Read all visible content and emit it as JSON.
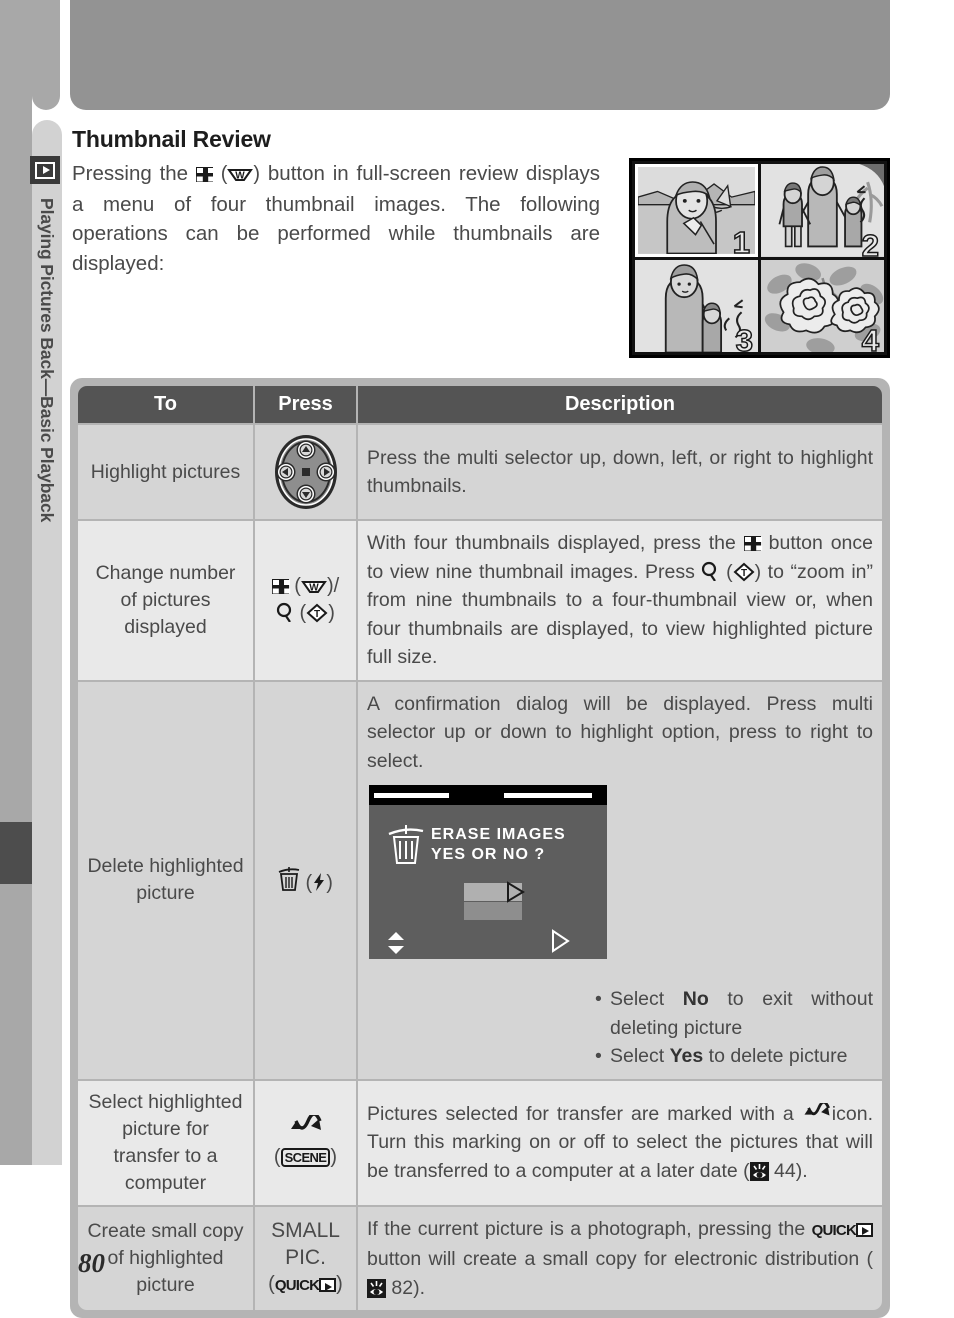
{
  "page": {
    "number": "80",
    "chapter_tab": "Playing Pictures Back—Basic Playback",
    "playback_icon": "playback-icon"
  },
  "section": {
    "title": "Thumbnail Review",
    "intro_before_icon": "Pressing the",
    "intro_after_icon": "button in full-screen review displays a menu of four thumbnail images.  The following operations can be performed while thumbnails are displayed:"
  },
  "thumbnails": {
    "items": [
      {
        "number": "1",
        "selected": true,
        "caption": "woman-beach-sailboat"
      },
      {
        "number": "2",
        "selected": false,
        "caption": "mother-with-two-children"
      },
      {
        "number": "3",
        "selected": false,
        "caption": "woman-holding-childs-hand"
      },
      {
        "number": "4",
        "selected": false,
        "caption": "flowers-close-up"
      }
    ]
  },
  "table": {
    "headers": {
      "to": "To",
      "press": "Press",
      "description": "Description"
    },
    "rows": [
      {
        "to": "Highlight pictures",
        "press_icon": "multi-selector",
        "description": "Press the multi selector up, down, left, or right to highlight thumbnails."
      },
      {
        "to": "Change number of pictures displayed",
        "press_line1": "( )/",
        "press_line2": "( )",
        "press_w": "W",
        "press_t": "T",
        "desc_p1": "With four thumbnails displayed, press the",
        "desc_p2": "button once to view nine thumbnail images.  Press",
        "desc_p3": "(",
        "desc_p4": ") to “zoom in” from nine thumbnails to a four-thumbnail view or, when four thumbnails are displayed, to view highlighted picture full size."
      },
      {
        "to": "Delete highlighted picture",
        "press_icon": "trash-icon",
        "press_paren": "flash-icon",
        "description": "A confirmation dialog will be displayed.  Press multi selector up or down to highlight option, press to right to select.",
        "lcd": {
          "line1": "ERASE IMAGES",
          "line2": "YES OR NO  ?"
        },
        "bullets": [
          {
            "pre": "Select ",
            "bold": "No",
            "post": " to exit without deleting picture"
          },
          {
            "pre": "Select ",
            "bold": "Yes",
            "post": " to delete picture"
          }
        ]
      },
      {
        "to": "Select highlighted picture for transfer to a computer",
        "press_icon": "transfer-icon",
        "press_label": "SCENE",
        "desc_p1": "Pictures selected for transfer are marked with a",
        "desc_p2": "icon.  Turn this marking on or off to select the pictures that will be transferred to a computer at a later date (",
        "desc_ref": "44",
        "desc_p3": ")."
      },
      {
        "to": "Create small copy of highlighted picture",
        "press_line1": "SMALL",
        "press_line2": "PIC.",
        "press_label": "QUICK",
        "desc_p1": "If the current picture is a photograph, pressing the",
        "desc_p2": "button will create a small copy for electronic distribution (",
        "desc_ref": "82",
        "desc_p3": ")."
      }
    ]
  },
  "colors": {
    "header_bar": "#939393",
    "tab": "#d2d2d2",
    "table_header": "#545454",
    "row_odd": "#d5d5d5",
    "row_even": "#e9e9e9",
    "table_border": "#b4b4b4",
    "text": "#4a4a4a"
  }
}
